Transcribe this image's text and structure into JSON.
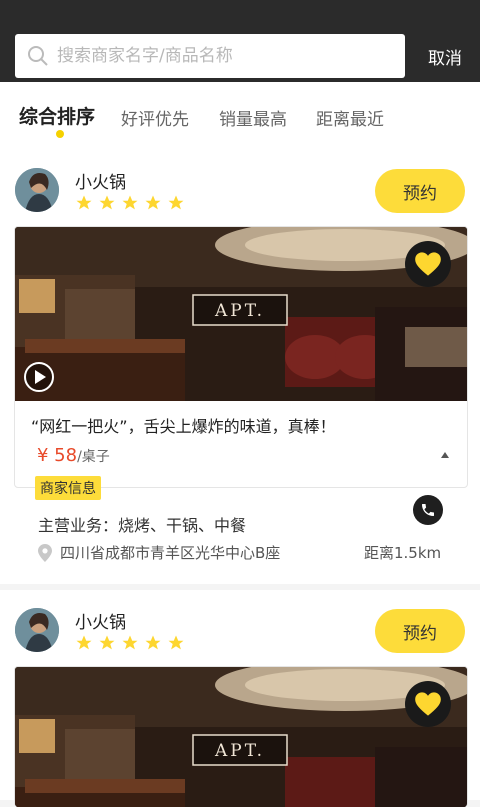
{
  "search": {
    "placeholder": "搜索商家名字/商品名称",
    "cancel_label": "取消"
  },
  "tabs": [
    {
      "label": "综合排序",
      "active": true
    },
    {
      "label": "好评优先",
      "active": false
    },
    {
      "label": "销量最高",
      "active": false
    },
    {
      "label": "距离最近",
      "active": false
    }
  ],
  "cards": [
    {
      "name": "小火锅",
      "rating": 5,
      "reserve_label": "预约",
      "sign_text": "APT.",
      "tagline": "“网红一把火”，舌尖上爆炸的味道，真棒！",
      "price": "¥ 58",
      "price_unit": "/桌子",
      "info_label": "商家信息",
      "business": "主营业务：烧烤、干锅、中餐",
      "address": "四川省成都市青羊区光华中心B座",
      "distance": "距离1.5km"
    },
    {
      "name": "小火锅",
      "rating": 5,
      "reserve_label": "预约",
      "sign_text": "APT."
    }
  ],
  "colors": {
    "accent": "#fddc3a",
    "price": "#e84a2a",
    "topbar": "#2b2b2b"
  }
}
